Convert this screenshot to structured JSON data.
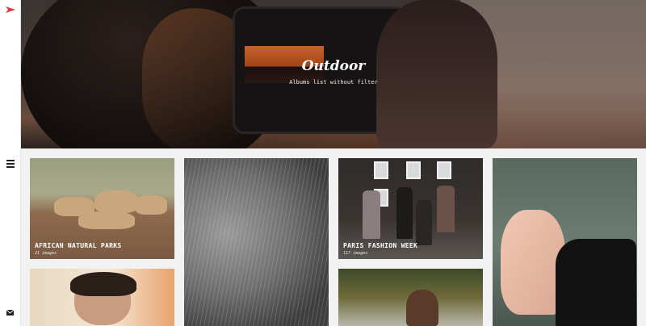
{
  "brand": {
    "logo_icon": "paper-plane-icon",
    "accent": "#e0383b"
  },
  "nav": {
    "menu_icon": "hamburger-menu-icon",
    "contact_icon": "envelope-icon"
  },
  "hero": {
    "title": "Outdoor",
    "subtitle": "Albums list without filter"
  },
  "albums": [
    {
      "name": "AFRICAN NATURAL PARKS",
      "count": "21 images"
    },
    {
      "name": "",
      "count": ""
    },
    {
      "name": "PARIS FASHION WEEK",
      "count": "117 images"
    },
    {
      "name": "",
      "count": ""
    },
    {
      "name": "",
      "count": ""
    },
    {
      "name": "",
      "count": ""
    }
  ]
}
